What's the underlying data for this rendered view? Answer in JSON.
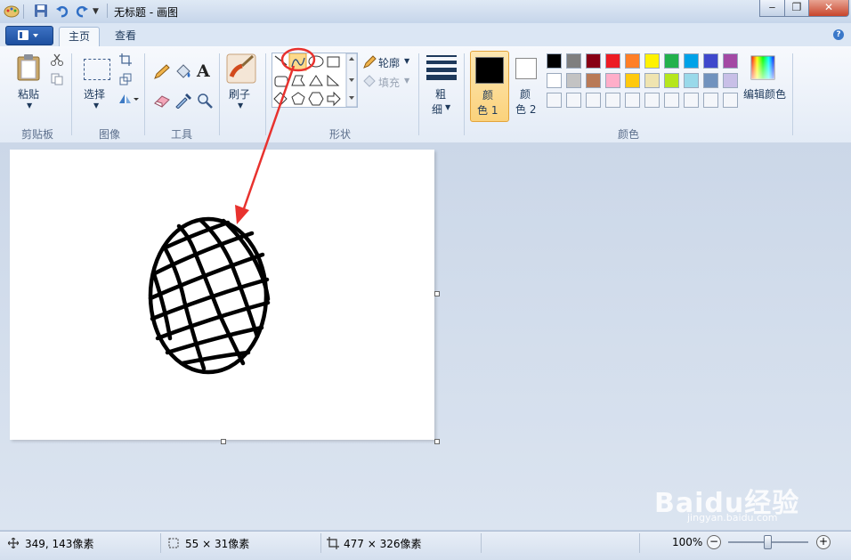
{
  "window": {
    "title": "无标题 - 画图",
    "minimize_glyph": "‒",
    "restore_glyph": "❐",
    "close_glyph": "✕"
  },
  "tabs": [
    {
      "label": "主页",
      "active": true
    },
    {
      "label": "查看",
      "active": false
    }
  ],
  "help_glyph": "?",
  "ribbon": {
    "clipboard": {
      "paste_label": "粘贴",
      "group_label": "剪贴板"
    },
    "image": {
      "select_label": "选择",
      "group_label": "图像"
    },
    "tools": {
      "group_label": "工具",
      "text_glyph": "A"
    },
    "brushes": {
      "label": "刷子"
    },
    "shapes": {
      "outline_label": "轮廓",
      "fill_label": "填充",
      "group_label": "形状"
    },
    "size": {
      "label_line1": "粗",
      "label_line2": "细"
    },
    "colors": {
      "color1_line1": "颜",
      "color1_line2": "色 1",
      "color2_line1": "颜",
      "color2_line2": "色 2",
      "edit_label": "编辑颜色",
      "group_label": "颜色",
      "color1_value": "#000000",
      "color2_value": "#ffffff",
      "palette_row1": [
        "#000000",
        "#7f7f7f",
        "#880015",
        "#ed1c24",
        "#ff7f27",
        "#fff200",
        "#22b14c",
        "#00a2e8",
        "#3f48cc",
        "#a349a4"
      ],
      "palette_row2": [
        "#ffffff",
        "#c3c3c3",
        "#b97a57",
        "#ffaec9",
        "#ffc90e",
        "#efe4b0",
        "#b5e61d",
        "#99d9ea",
        "#7092be",
        "#c8bfe7"
      ]
    }
  },
  "status": {
    "cursor_pos": "349, 143像素",
    "selection_size": "55 × 31像素",
    "image_size": "477 × 326像素",
    "zoom": "100%",
    "zoom_out_glyph": "−",
    "zoom_in_glyph": "+"
  },
  "watermark": {
    "text": "Baidu经验",
    "sub": "jingyan.baidu.com"
  }
}
